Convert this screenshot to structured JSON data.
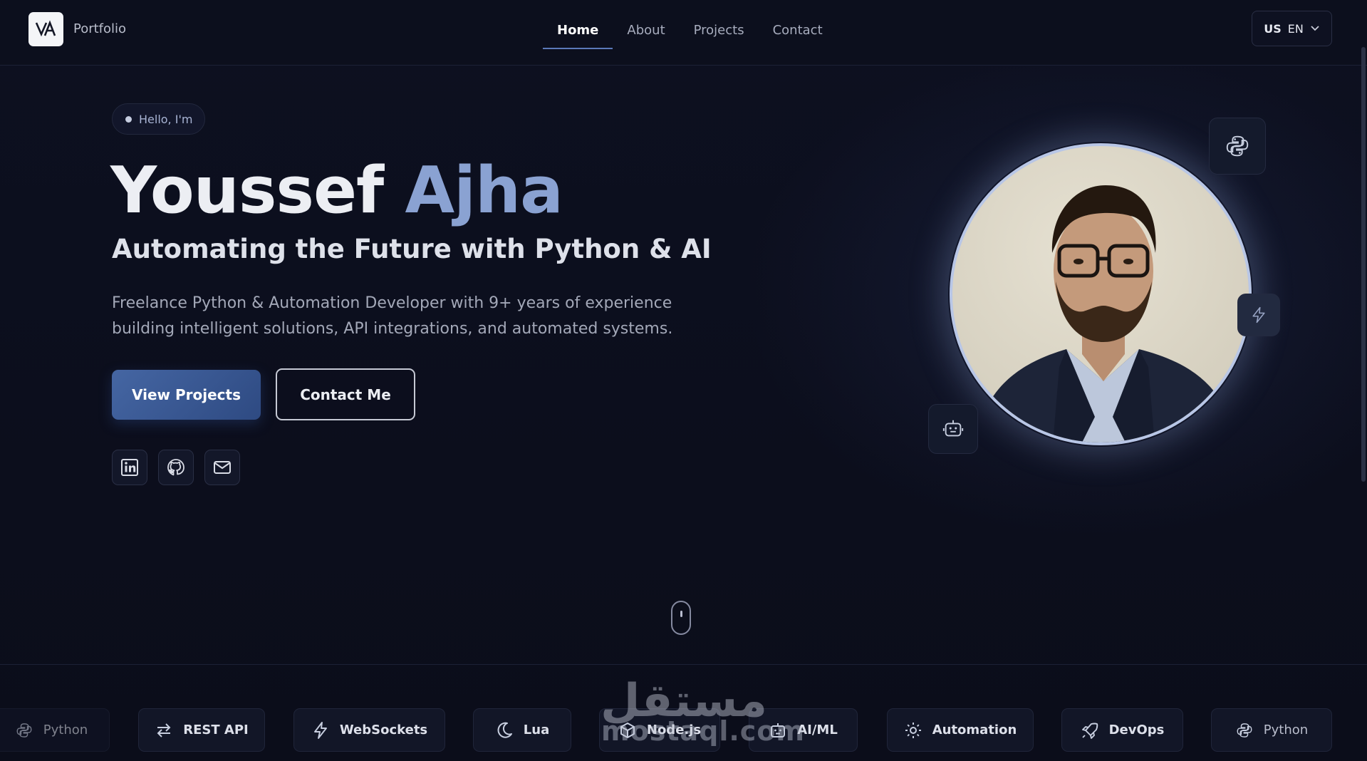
{
  "nav": {
    "brand": "Portfolio",
    "links": [
      {
        "label": "Home",
        "active": true
      },
      {
        "label": "About",
        "active": false
      },
      {
        "label": "Projects",
        "active": false
      },
      {
        "label": "Contact",
        "active": false
      }
    ],
    "language": {
      "flag_text": "US",
      "code": "EN"
    }
  },
  "hero": {
    "greeting": "Hello, I'm",
    "first_name": "Youssef",
    "last_name": "Ajha",
    "tagline": "Automating the Future with Python & AI",
    "description": "Freelance Python & Automation Developer with 9+ years of experience building intelligent solutions, API integrations, and automated systems.",
    "primary_button": "View Projects",
    "secondary_button": "Contact Me",
    "socials": [
      "linkedin-icon",
      "github-icon",
      "mail-icon"
    ]
  },
  "floating_icons": [
    "python-icon",
    "lightning-icon",
    "robot-icon"
  ],
  "tech_strip": [
    {
      "label": "Python",
      "icon": "python-icon"
    },
    {
      "label": "REST API",
      "icon": "arrows-icon"
    },
    {
      "label": "WebSockets",
      "icon": "lightning-icon"
    },
    {
      "label": "Lua",
      "icon": "moon-icon"
    },
    {
      "label": "Node.js",
      "icon": "cube-icon"
    },
    {
      "label": "AI/ML",
      "icon": "robot-icon"
    },
    {
      "label": "Automation",
      "icon": "gear-icon"
    },
    {
      "label": "DevOps",
      "icon": "rocket-icon"
    },
    {
      "label": "Python",
      "icon": "python-icon"
    }
  ],
  "watermark": {
    "arabic": "مستقل",
    "latin": "mostaql.com"
  },
  "colors": {
    "background": "#0c0e1b",
    "accent": "#5b79b9",
    "name_highlight": "#8aa2d2"
  }
}
